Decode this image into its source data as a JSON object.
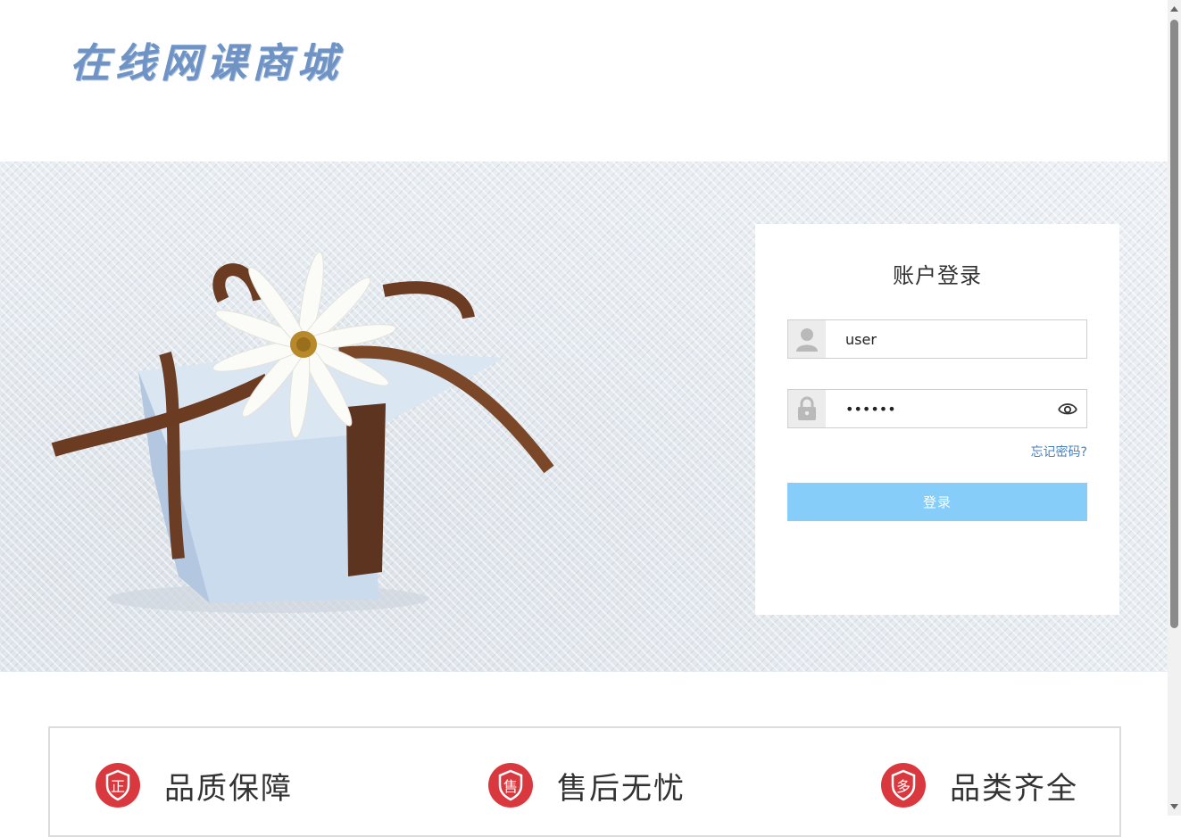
{
  "header": {
    "logo_text": "在线网课商城"
  },
  "login": {
    "title": "账户登录",
    "username_value": "user",
    "password_value": "••••••",
    "forgot_label": "忘记密码?",
    "submit_label": "登录"
  },
  "features": [
    {
      "badge_char": "正",
      "label": "品质保障"
    },
    {
      "badge_char": "售",
      "label": "售后无忧"
    },
    {
      "badge_char": "多",
      "label": "品类齐全"
    }
  ],
  "colors": {
    "logo": "#6e93c4",
    "button": "#86cdf9",
    "link": "#4a7fbf",
    "badge": "#d9393e"
  },
  "icons": [
    "user-icon",
    "lock-icon",
    "eye-icon",
    "scroll-up-arrow-icon",
    "scroll-down-arrow-icon"
  ]
}
